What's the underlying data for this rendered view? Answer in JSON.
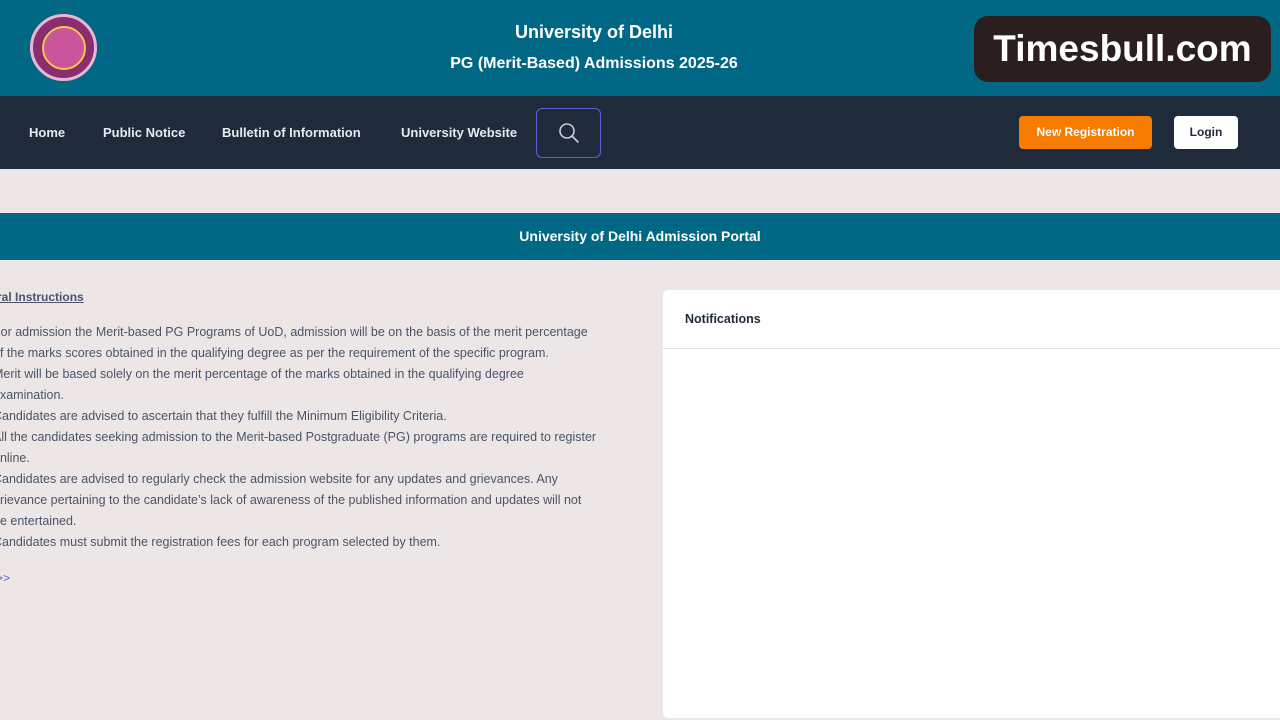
{
  "header": {
    "university_name": "University of Delhi",
    "admission_title": "PG (Merit-Based) Admissions 2025-26",
    "watermark": "Timesbull.com"
  },
  "nav": {
    "links": [
      "Home",
      "Public Notice",
      "Bulletin of Information",
      "University Website"
    ],
    "new_registration": "New Registration",
    "login": "Login"
  },
  "portal_title": "University of Delhi Admission Portal",
  "instructions": {
    "heading": "General Instructions",
    "lines": [
      "For admission the Merit-based PG Programs of UoD, admission will be on the basis of the merit percentage",
      "of the marks scores obtained in the qualifying degree as per the requirement of the specific program.",
      "Merit will be based solely on the merit percentage of the marks obtained in the qualifying degree",
      "examination.",
      "Candidates are advised to ascertain that they fulfill the Minimum Eligibility Criteria.",
      "All the candidates seeking admission to the Merit-based Postgraduate (PG) programs are required to register",
      "online.",
      "Candidates are advised to regularly check the admission website for any updates and grievances. Any",
      "grievance pertaining to the candidate’s lack of awareness of the published information and updates will not",
      "be entertained.",
      "Candidates must submit the registration fees for each program selected by them."
    ],
    "more_link": ">>"
  },
  "notifications": {
    "title": "Notifications"
  },
  "colors": {
    "header_teal": "#006884",
    "nav_dark": "#1f2a3b",
    "register_orange": "#f57c00",
    "page_bg": "#ece7e6"
  }
}
